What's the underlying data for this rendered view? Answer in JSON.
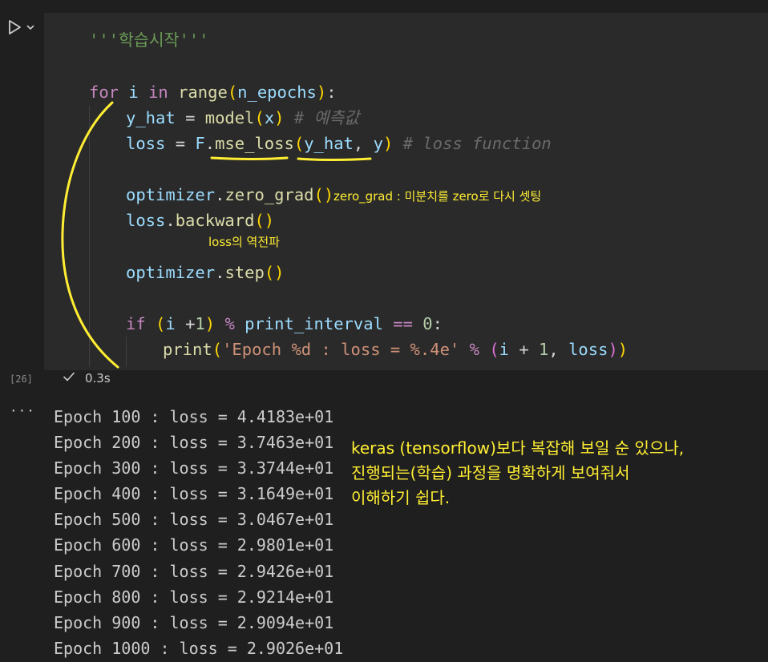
{
  "cell": {
    "execution_count": "[26]",
    "exec_time": "0.3s",
    "code": {
      "docstring": "'''학습시작'''",
      "for_kw": "for",
      "for_var": "i",
      "in_kw": "in",
      "range_fn": "range",
      "range_arg": "n_epochs",
      "yhat_var": "y_hat",
      "model_fn": "model",
      "x_arg": "x",
      "comment_pred": "# 예측값",
      "loss_var": "loss",
      "f_obj": "F",
      "mse_fn": "mse_loss",
      "yhat_arg": "y_hat",
      "y_arg": "y",
      "comment_loss": "# loss function",
      "opt_var": "optimizer",
      "zero_grad_fn": "zero_grad",
      "loss_var2": "loss",
      "backward_fn": "backward",
      "opt_var2": "optimizer",
      "step_fn": "step",
      "if_kw": "if",
      "if_i": "i",
      "if_one": "1",
      "mod_op": "%",
      "interval_var": "print_interval",
      "eq_op": "==",
      "zero_num": "0",
      "print_fn": "print",
      "fmt_str": "'Epoch %d : loss = %.4e'",
      "fmt_op": "%",
      "tuple_i": "i",
      "tuple_one": "1",
      "tuple_loss": "loss"
    }
  },
  "output": {
    "more_icon": "ellipsis-icon",
    "lines": [
      "Epoch 100 : loss = 4.4183e+01",
      "Epoch 200 : loss = 3.7463e+01",
      "Epoch 300 : loss = 3.3744e+01",
      "Epoch 400 : loss = 3.1649e+01",
      "Epoch 500 : loss = 3.0467e+01",
      "Epoch 600 : loss = 2.9801e+01",
      "Epoch 700 : loss = 2.9426e+01",
      "Epoch 800 : loss = 2.9214e+01",
      "Epoch 900 : loss = 2.9094e+01",
      "Epoch 1000 : loss = 2.9026e+01"
    ]
  },
  "annotations": {
    "zero_grad_note": "zero_grad : 미분치를 zero로 다시 셋팅",
    "backward_note": "loss의 역전파",
    "summary_lines": [
      "keras (tensorflow)보다 복잡해 보일 순 있으나,",
      "진행되는(학습) 과정을 명확하게 보여줘서",
      "이해하기 쉽다."
    ],
    "color": "#ffee33"
  },
  "icons": {
    "run": "play-icon",
    "run_menu": "chevron-down-icon",
    "success": "check-icon"
  },
  "theme": {
    "background": "#1f1f1f",
    "cell_background": "#2a2a2a",
    "keyword": "#c586c0",
    "function": "#dcdcaa",
    "variable": "#9cdcfe",
    "string": "#ce9178"
  }
}
